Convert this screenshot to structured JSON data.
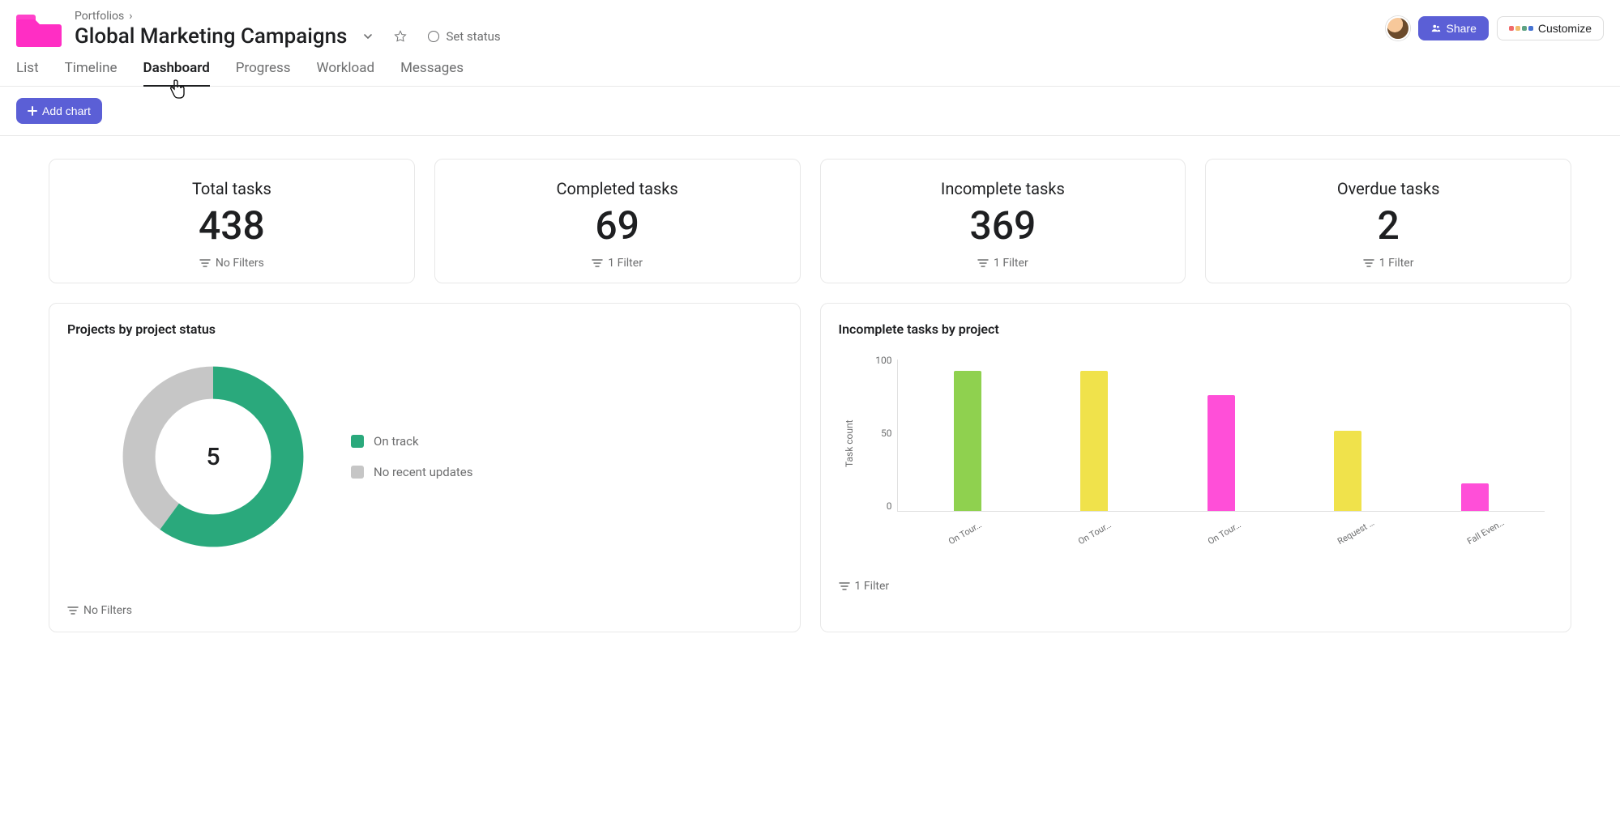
{
  "breadcrumb": {
    "root": "Portfolios"
  },
  "page": {
    "title": "Global Marketing Campaigns",
    "set_status_label": "Set status"
  },
  "header_actions": {
    "share_label": "Share",
    "customize_label": "Customize"
  },
  "tabs": [
    {
      "label": "List"
    },
    {
      "label": "Timeline"
    },
    {
      "label": "Dashboard",
      "active": true
    },
    {
      "label": "Progress"
    },
    {
      "label": "Workload"
    },
    {
      "label": "Messages"
    }
  ],
  "toolbar": {
    "add_chart_label": "Add chart"
  },
  "stats": [
    {
      "label": "Total tasks",
      "value": "438",
      "filter": "No Filters"
    },
    {
      "label": "Completed tasks",
      "value": "69",
      "filter": "1 Filter"
    },
    {
      "label": "Incomplete tasks",
      "value": "369",
      "filter": "1 Filter"
    },
    {
      "label": "Overdue tasks",
      "value": "2",
      "filter": "1 Filter"
    }
  ],
  "charts": {
    "donut": {
      "title": "Projects by project status",
      "center_value": "5",
      "filter": "No Filters",
      "legend": [
        {
          "name": "On track",
          "color": "#2aa97c"
        },
        {
          "name": "No recent updates",
          "color": "#c6c6c6"
        }
      ]
    },
    "bar": {
      "title": "Incomplete tasks by project",
      "ylabel": "Task count",
      "yticks": [
        "100",
        "50",
        "0"
      ],
      "filter": "1 Filter"
    }
  },
  "chart_data": [
    {
      "type": "pie",
      "title": "Projects by project status",
      "total": 5,
      "series": [
        {
          "name": "On track",
          "value": 3,
          "color": "#2aa97c"
        },
        {
          "name": "No recent updates",
          "value": 2,
          "color": "#c6c6c6"
        }
      ]
    },
    {
      "type": "bar",
      "title": "Incomplete tasks by project",
      "ylabel": "Task count",
      "ylim": [
        0,
        110
      ],
      "yticks": [
        0,
        50,
        100
      ],
      "categories": [
        "On Tour…",
        "On Tour…",
        "On Tour…",
        "Request …",
        "Fall Even…"
      ],
      "values": [
        102,
        102,
        84,
        58,
        20
      ],
      "colors": [
        "#8fd14f",
        "#f0e24b",
        "#ff4fd8",
        "#f0e24b",
        "#ff4fd8"
      ]
    }
  ]
}
